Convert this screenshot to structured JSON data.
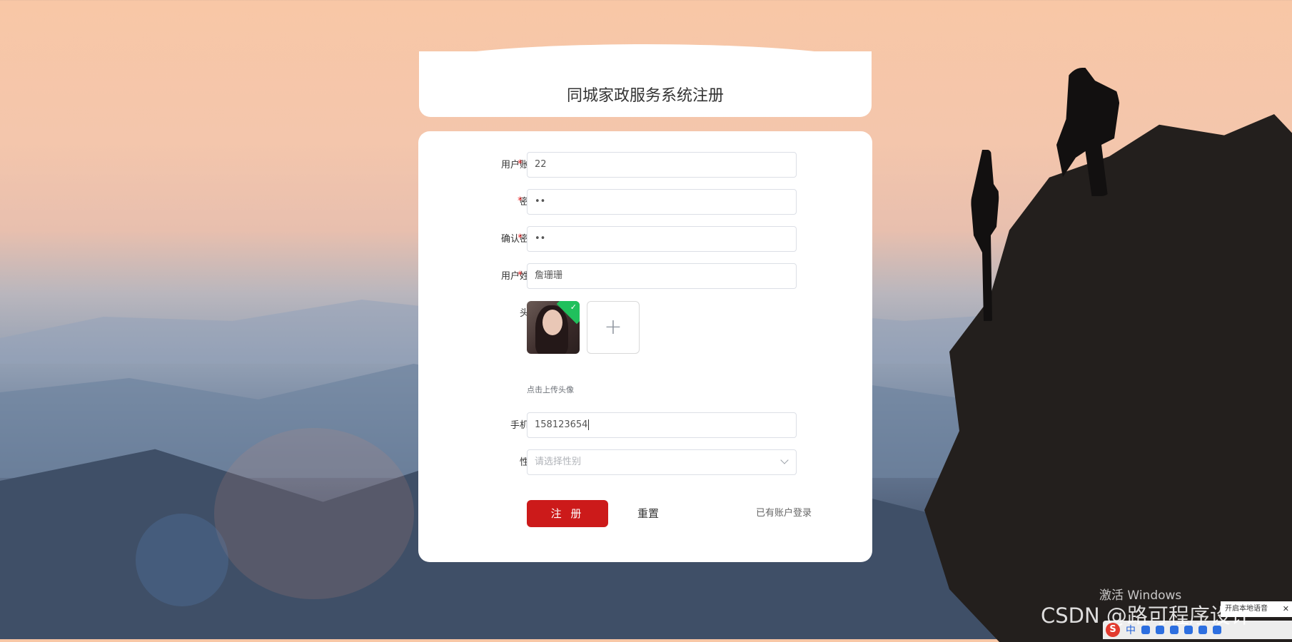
{
  "title": "同城家政服务系统注册",
  "form": {
    "account": {
      "label": "用户账号：",
      "required_mark": "*",
      "value": "22"
    },
    "password": {
      "label": "密码：",
      "required_mark": "*",
      "value": "••"
    },
    "confirm_password": {
      "label": "确认密码：",
      "required_mark": "*",
      "value": "••"
    },
    "name": {
      "label": "用户姓名：",
      "required_mark": "*",
      "value": "詹珊珊"
    },
    "avatar": {
      "label": "头像：",
      "upload_plus": "+",
      "upload_hint": "点击上传头像",
      "tick": "✓"
    },
    "phone": {
      "label": "手机号：",
      "value": "158123654"
    },
    "gender": {
      "label": "性别：",
      "placeholder": "请选择性别"
    }
  },
  "actions": {
    "register": "注 册",
    "reset": "重置",
    "login_link": "已有账户登录"
  },
  "overlay": {
    "windows_activate": "激活 Windows",
    "csdn_watermark": "CSDN @路可程序设计",
    "ime": {
      "logo": "S",
      "mode": "中"
    },
    "tray_popup": "开启本地语音",
    "tray_close": "✕"
  },
  "colors": {
    "accent": "#cc1a1a",
    "required": "#e3292b",
    "card": "#ffffff"
  }
}
